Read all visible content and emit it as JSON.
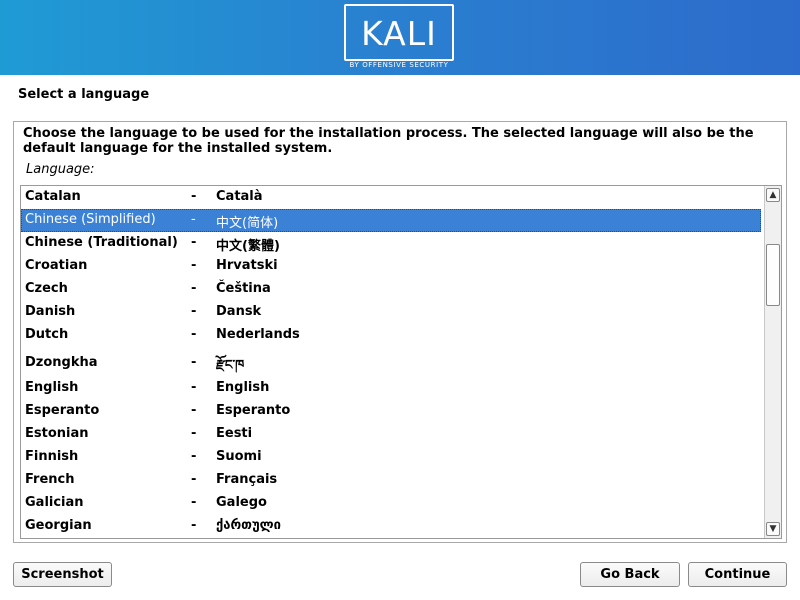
{
  "banner": {
    "logo_text": "KALI",
    "logo_subtitle": "BY OFFENSIVE SECURITY",
    "color": "#2a7fd0"
  },
  "page_title": "Select a language",
  "description": "Choose the language to be used for the installation process. The selected language will also be the default language for the installed system.",
  "language_label": "Language:",
  "languages": [
    {
      "name": "Catalan",
      "native": "Català",
      "selected": false
    },
    {
      "name": "Chinese (Simplified)",
      "native": "中文(简体)",
      "selected": true
    },
    {
      "name": "Chinese (Traditional)",
      "native": "中文(繁體)",
      "selected": false
    },
    {
      "name": "Croatian",
      "native": "Hrvatski",
      "selected": false
    },
    {
      "name": "Czech",
      "native": "Čeština",
      "selected": false
    },
    {
      "name": "Danish",
      "native": "Dansk",
      "selected": false
    },
    {
      "name": "Dutch",
      "native": "Nederlands",
      "selected": false
    },
    {
      "name": "Dzongkha",
      "native": "རྫོང་ཁ",
      "selected": false
    },
    {
      "name": "English",
      "native": "English",
      "selected": false
    },
    {
      "name": "Esperanto",
      "native": "Esperanto",
      "selected": false
    },
    {
      "name": "Estonian",
      "native": "Eesti",
      "selected": false
    },
    {
      "name": "Finnish",
      "native": "Suomi",
      "selected": false
    },
    {
      "name": "French",
      "native": "Français",
      "selected": false
    },
    {
      "name": "Galician",
      "native": "Galego",
      "selected": false
    },
    {
      "name": "Georgian",
      "native": "ქართული",
      "selected": false
    }
  ],
  "separator": "-",
  "selection_color": "#3b82d6",
  "buttons": {
    "screenshot": "Screenshot",
    "go_back": "Go Back",
    "continue": "Continue"
  }
}
